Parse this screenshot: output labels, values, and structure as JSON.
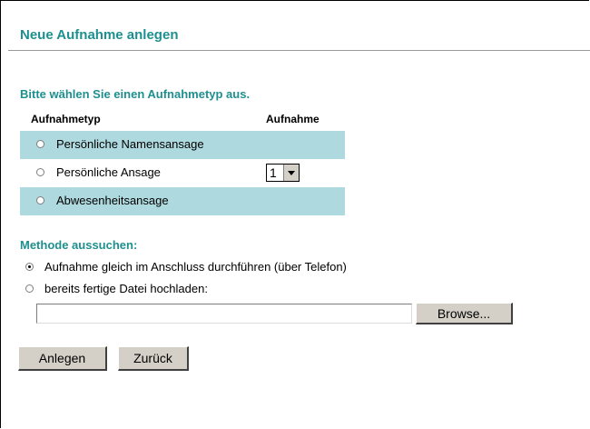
{
  "page_title": "Neue Aufnahme anlegen",
  "type_section": {
    "heading": "Bitte wählen Sie einen Aufnahmetyp aus.",
    "col_type": "Aufnahmetyp",
    "col_recording": "Aufnahme",
    "options": [
      {
        "label": "Persönliche Namensansage",
        "selected": false
      },
      {
        "label": "Persönliche Ansage",
        "selected": false,
        "recording": "1"
      },
      {
        "label": "Abwesenheitsansage",
        "selected": false
      }
    ]
  },
  "method_section": {
    "heading": "Methode aussuchen:",
    "options": [
      {
        "label": "Aufnahme gleich im Anschluss durchführen (über Telefon)",
        "selected": true
      },
      {
        "label": "bereits fertige Datei hochladen:",
        "selected": false
      }
    ],
    "file_value": "",
    "browse_label": "Browse..."
  },
  "buttons": {
    "create_label": "Anlegen",
    "back_label": "Zurück"
  }
}
